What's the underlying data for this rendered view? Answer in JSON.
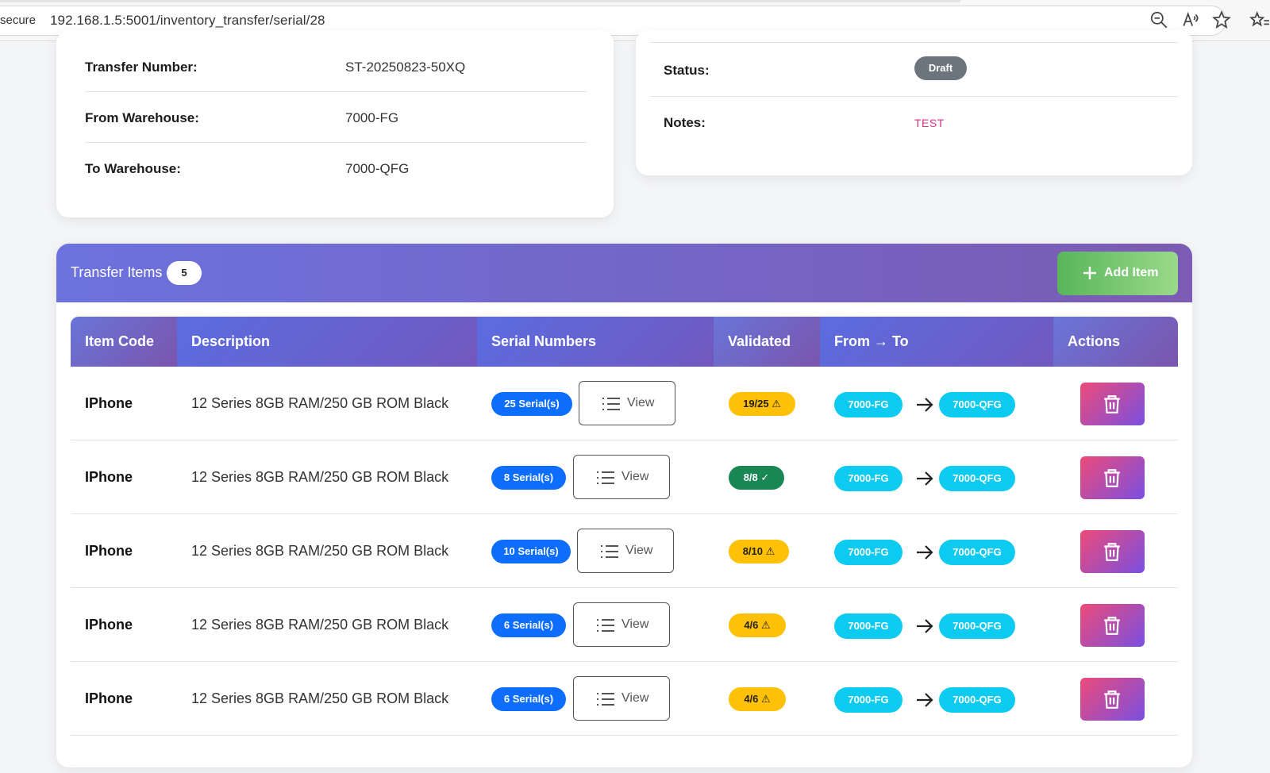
{
  "browser": {
    "secure_label": "secure",
    "url": "192.168.1.5:5001/inventory_transfer/serial/28"
  },
  "transfer_info": {
    "transfer_number_label": "Transfer Number:",
    "transfer_number": "ST-20250823-50XQ",
    "from_warehouse_label": "From Warehouse:",
    "from_warehouse": "7000-FG",
    "to_warehouse_label": "To Warehouse:",
    "to_warehouse": "7000-QFG"
  },
  "status_info": {
    "status_label": "Status:",
    "status": "Draft",
    "notes_label": "Notes:",
    "notes": "TEST"
  },
  "items_panel": {
    "title": "Transfer Items",
    "count": "5",
    "add_label": "Add Item",
    "columns": [
      "Item Code",
      "Description",
      "Serial Numbers",
      "Validated",
      "From → To",
      "Actions"
    ],
    "view_label": "View",
    "rows": [
      {
        "code": "IPhone",
        "description": "12 Series 8GB RAM/250 GB ROM Black",
        "serials": "25 Serial(s)",
        "validated": "19/25 ⚠",
        "validated_state": "warning",
        "from": "7000-FG",
        "to": "7000-QFG"
      },
      {
        "code": "IPhone",
        "description": "12 Series 8GB RAM/250 GB ROM Black",
        "serials": "8 Serial(s)",
        "validated": "8/8 ✓",
        "validated_state": "ok",
        "from": "7000-FG",
        "to": "7000-QFG"
      },
      {
        "code": "IPhone",
        "description": "12 Series 8GB RAM/250 GB ROM Black",
        "serials": "10 Serial(s)",
        "validated": "8/10 ⚠",
        "validated_state": "warning",
        "from": "7000-FG",
        "to": "7000-QFG"
      },
      {
        "code": "IPhone",
        "description": "12 Series 8GB RAM/250 GB ROM Black",
        "serials": "6 Serial(s)",
        "validated": "4/6 ⚠",
        "validated_state": "warning",
        "from": "7000-FG",
        "to": "7000-QFG"
      },
      {
        "code": "IPhone",
        "description": "12 Series 8GB RAM/250 GB ROM Black",
        "serials": "6 Serial(s)",
        "validated": "4/6 ⚠",
        "validated_state": "warning",
        "from": "7000-FG",
        "to": "7000-QFG"
      }
    ]
  },
  "colors": {
    "header_gradient_start": "#6c72de",
    "header_gradient_end": "#7b5bb3",
    "status_draft": "#6c757d",
    "notes": "#d63384",
    "serial_badge": "#0d6efd",
    "warning": "#ffc107",
    "success": "#198754",
    "warehouse_badge": "#0dcaf0",
    "add_button": "#58b55b"
  },
  "icons": [
    "zoom-out-icon",
    "read-aloud-icon",
    "favorite-star-icon",
    "favorites-list-icon",
    "plus-icon",
    "list-icon",
    "arrow-right-icon",
    "trash-icon"
  ]
}
